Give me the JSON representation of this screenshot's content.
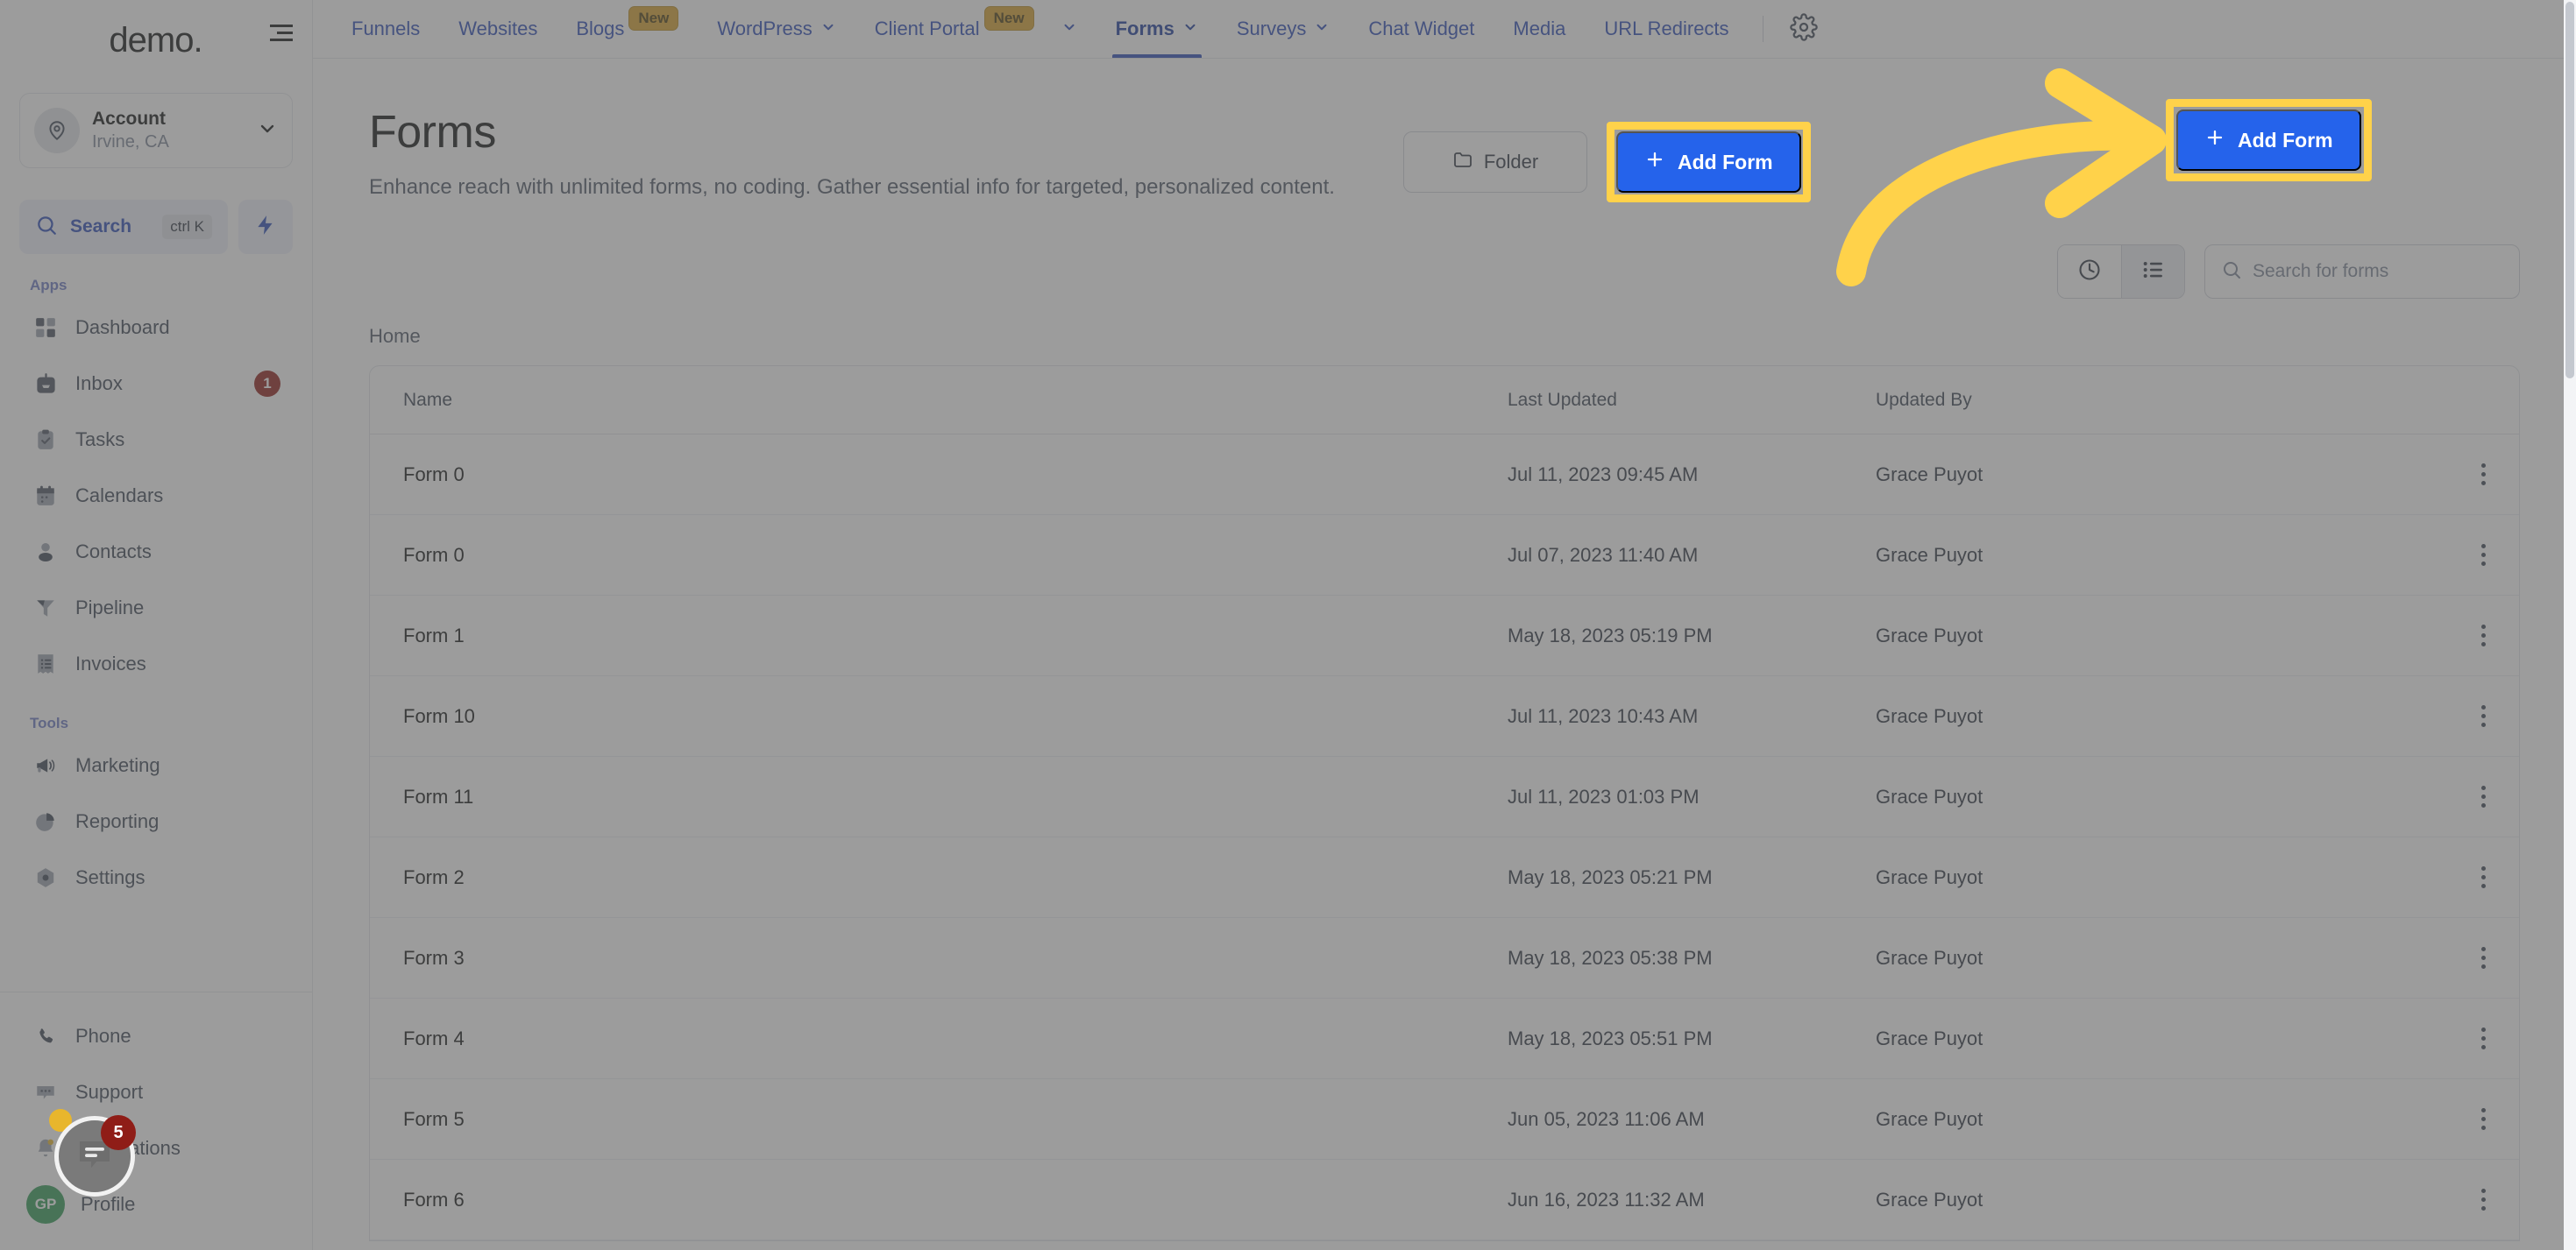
{
  "brand": {
    "logo_text": "demo",
    "logo_dot": "."
  },
  "sidebar": {
    "account": {
      "name": "Account",
      "location": "Irvine, CA",
      "icon": "location-pin-icon",
      "chevron": "chevron-down-icon"
    },
    "search": {
      "label": "Search",
      "shortcut": "ctrl K",
      "icon": "search-icon",
      "bolt_icon": "bolt-icon"
    },
    "groups": [
      {
        "label": "Apps",
        "items": [
          {
            "label": "Dashboard",
            "icon": "dashboard-grid-icon",
            "badge": ""
          },
          {
            "label": "Inbox",
            "icon": "inbox-icon",
            "badge": "1"
          },
          {
            "label": "Tasks",
            "icon": "clipboard-check-icon",
            "badge": ""
          },
          {
            "label": "Calendars",
            "icon": "calendar-icon",
            "badge": ""
          },
          {
            "label": "Contacts",
            "icon": "person-icon",
            "badge": ""
          },
          {
            "label": "Pipeline",
            "icon": "funnel-icon",
            "badge": ""
          },
          {
            "label": "Invoices",
            "icon": "invoice-list-icon",
            "badge": ""
          }
        ]
      },
      {
        "label": "Tools",
        "items": [
          {
            "label": "Marketing",
            "icon": "megaphone-icon",
            "badge": ""
          },
          {
            "label": "Reporting",
            "icon": "pie-chart-icon",
            "badge": ""
          },
          {
            "label": "Settings",
            "icon": "gear-hex-icon",
            "badge": ""
          }
        ]
      }
    ],
    "bottom_items": [
      {
        "label": "Phone",
        "icon": "phone-icon"
      },
      {
        "label": "Support",
        "icon": "chat-dots-icon"
      },
      {
        "label": "Notifications",
        "icon": "bell-icon"
      },
      {
        "label": "Profile",
        "icon": "avatar-icon"
      }
    ],
    "profile_initials": "GP"
  },
  "topnav": {
    "items": [
      {
        "label": "Funnels",
        "badge": "",
        "caret": false,
        "active": false
      },
      {
        "label": "Websites",
        "badge": "",
        "caret": false,
        "active": false
      },
      {
        "label": "Blogs",
        "badge": "New",
        "caret": false,
        "active": false
      },
      {
        "label": "WordPress",
        "badge": "",
        "caret": true,
        "active": false
      },
      {
        "label": "Client Portal",
        "badge": "New",
        "caret": true,
        "active": false
      },
      {
        "label": "Forms",
        "badge": "",
        "caret": true,
        "active": true
      },
      {
        "label": "Surveys",
        "badge": "",
        "caret": true,
        "active": false
      },
      {
        "label": "Chat Widget",
        "badge": "",
        "caret": false,
        "active": false
      },
      {
        "label": "Media",
        "badge": "",
        "caret": false,
        "active": false
      },
      {
        "label": "URL Redirects",
        "badge": "",
        "caret": false,
        "active": false
      }
    ],
    "settings_icon": "gear-icon"
  },
  "page": {
    "title": "Forms",
    "subtitle": "Enhance reach with unlimited forms, no coding. Gather essential info for targeted, personalized content.",
    "folder_button_label": "Folder",
    "folder_button_icon": "folder-icon",
    "add_button_label": "Add Form",
    "add_button_icon": "plus-icon",
    "breadcrumb": "Home"
  },
  "toolbar": {
    "recent_icon": "clock-icon",
    "list_icon": "list-view-icon",
    "search_placeholder": "Search for forms",
    "search_value": "",
    "search_icon": "search-icon"
  },
  "table": {
    "columns": [
      "Name",
      "Last Updated",
      "Updated By"
    ],
    "rows": [
      {
        "name": "Form 0",
        "updated": "Jul 11, 2023 09:45 AM",
        "by": "Grace Puyot"
      },
      {
        "name": "Form 0",
        "updated": "Jul 07, 2023 11:40 AM",
        "by": "Grace Puyot"
      },
      {
        "name": "Form 1",
        "updated": "May 18, 2023 05:19 PM",
        "by": "Grace Puyot"
      },
      {
        "name": "Form 10",
        "updated": "Jul 11, 2023 10:43 AM",
        "by": "Grace Puyot"
      },
      {
        "name": "Form 11",
        "updated": "Jul 11, 2023 01:03 PM",
        "by": "Grace Puyot"
      },
      {
        "name": "Form 2",
        "updated": "May 18, 2023 05:21 PM",
        "by": "Grace Puyot"
      },
      {
        "name": "Form 3",
        "updated": "May 18, 2023 05:38 PM",
        "by": "Grace Puyot"
      },
      {
        "name": "Form 4",
        "updated": "May 18, 2023 05:51 PM",
        "by": "Grace Puyot"
      },
      {
        "name": "Form 5",
        "updated": "Jun 05, 2023 11:06 AM",
        "by": "Grace Puyot"
      },
      {
        "name": "Form 6",
        "updated": "Jun 16, 2023 11:32 AM",
        "by": "Grace Puyot"
      }
    ],
    "row_menu_icon": "kebab-menu-icon"
  },
  "chat_widget": {
    "badge": "5",
    "icon": "chat-bubble-icon"
  },
  "annotation": {
    "arrow_color": "#FFD24A",
    "highlight_color": "#FFD24A",
    "arrow_icon": "curved-arrow-right-icon"
  },
  "colors": {
    "accent_blue": "#2563eb",
    "nav_blue": "#2a4ab7",
    "badge_red": "#8f1d17",
    "new_pill": "#d8a12c",
    "highlight_yellow": "#FFD24A",
    "avatar_green": "#2f9a54"
  }
}
